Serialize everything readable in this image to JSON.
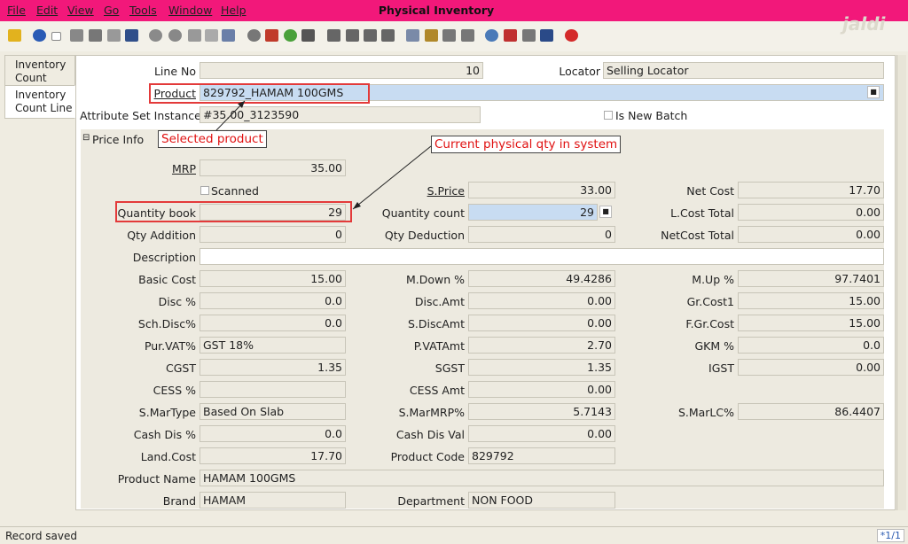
{
  "window": {
    "title": "Physical Inventory",
    "brand": "jaldi"
  },
  "menu": [
    "File",
    "Edit",
    "View",
    "Go",
    "Tools",
    "Window",
    "Help"
  ],
  "tabs": [
    {
      "label_1": "Inventory",
      "label_2": "Count"
    },
    {
      "label_1": "Inventory",
      "label_2": "Count Line"
    }
  ],
  "header": {
    "line_no_label": "Line No",
    "line_no": "10",
    "locator_label": "Locator",
    "locator": "Selling Locator",
    "product_label": "Product",
    "product": "829792_HAMAM 100GMS",
    "asi_label": "Attribute Set Instance",
    "asi": "#35.00_3123590",
    "is_new_batch_label": "Is New Batch",
    "section_label": "Price Info",
    "section_toggle": "⊟"
  },
  "annotations": {
    "selected_product": "Selected product",
    "current_qty": "Current physical qty in system"
  },
  "fields": {
    "mrp_label": "MRP",
    "mrp": "35.00",
    "scanned_label": "Scanned",
    "sprice_label": "S.Price",
    "sprice": "33.00",
    "netcost_label": "Net Cost",
    "netcost": "17.70",
    "qtybook_label": "Quantity book",
    "qtybook": "29",
    "qtycount_label": "Quantity count",
    "qtycount": "29",
    "lcosttotal_label": "L.Cost Total",
    "lcosttotal": "0.00",
    "qtyadd_label": "Qty Addition",
    "qtyadd": "0",
    "qtyded_label": "Qty Deduction",
    "qtyded": "0",
    "netcosttotal_label": "NetCost Total",
    "netcosttotal": "0.00",
    "desc_label": "Description",
    "desc": "",
    "basiccost_label": "Basic Cost",
    "basiccost": "15.00",
    "mdown_label": "M.Down %",
    "mdown": "49.4286",
    "mup_label": "M.Up %",
    "mup": "97.7401",
    "disc_label": "Disc %",
    "disc": "0.0",
    "discamt_label": "Disc.Amt",
    "discamt": "0.00",
    "grcost1_label": "Gr.Cost1",
    "grcost1": "15.00",
    "schdisc_label": "Sch.Disc%",
    "schdisc": "0.0",
    "sdiscamt_label": "S.DiscAmt",
    "sdiscamt": "0.00",
    "fgrcost_label": "F.Gr.Cost",
    "fgrcost": "15.00",
    "purvat_label": "Pur.VAT%",
    "purvat": "GST 18%",
    "pvatamt_label": "P.VATAmt",
    "pvatamt": "2.70",
    "gkm_label": "GKM %",
    "gkm": "0.0",
    "cgst_label": "CGST",
    "cgst": "1.35",
    "sgst_label": "SGST",
    "sgst": "1.35",
    "igst_label": "IGST",
    "igst": "0.00",
    "cess_label": "CESS %",
    "cess": "",
    "cessamt_label": "CESS Amt",
    "cessamt": "0.00",
    "smartype_label": "S.MarType",
    "smartype": "Based On Slab",
    "smarmrp_label": "S.MarMRP%",
    "smarmrp": "5.7143",
    "smarlc_label": "S.MarLC%",
    "smarlc": "86.4407",
    "cashdis_label": "Cash Dis %",
    "cashdis": "0.0",
    "cashdisval_label": "Cash Dis Val",
    "cashdisval": "0.00",
    "landcost_label": "Land.Cost",
    "landcost": "17.70",
    "prodcode_label": "Product Code",
    "prodcode": "829792",
    "prodname_label": "Product Name",
    "prodname": "HAMAM 100GMS",
    "brand_label": "Brand",
    "brand": "HAMAM",
    "dept_label": "Department",
    "dept": "NON FOOD"
  },
  "status": {
    "text": "Record saved",
    "page": "*1/1"
  }
}
